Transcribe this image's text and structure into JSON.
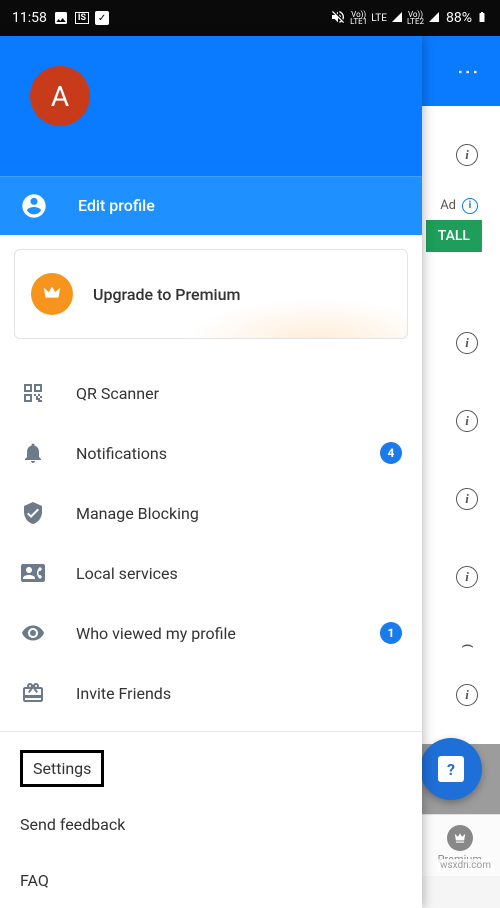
{
  "statusbar": {
    "time": "11:58",
    "battery_pct": "88%",
    "lte1_top": "Vo))",
    "lte1_bot": "LTE1",
    "lte_label": "LTE",
    "lte2_top": "Vo))",
    "lte2_bot": "LTE2"
  },
  "background": {
    "ad_label": "Ad",
    "install_button": "TALL"
  },
  "drawer": {
    "avatar_initial": "A",
    "edit_profile": "Edit profile",
    "premium": "Upgrade to Premium",
    "menu": {
      "qr": "QR Scanner",
      "notifications": "Notifications",
      "notifications_badge": "4",
      "blocking": "Manage Blocking",
      "local": "Local services",
      "viewed": "Who viewed my profile",
      "viewed_badge": "1",
      "invite": "Invite Friends"
    },
    "footer": {
      "settings": "Settings",
      "feedback": "Send feedback",
      "faq": "FAQ"
    }
  },
  "bottom_nav": {
    "premium": "Premium"
  },
  "watermark": "wsxdn.com"
}
